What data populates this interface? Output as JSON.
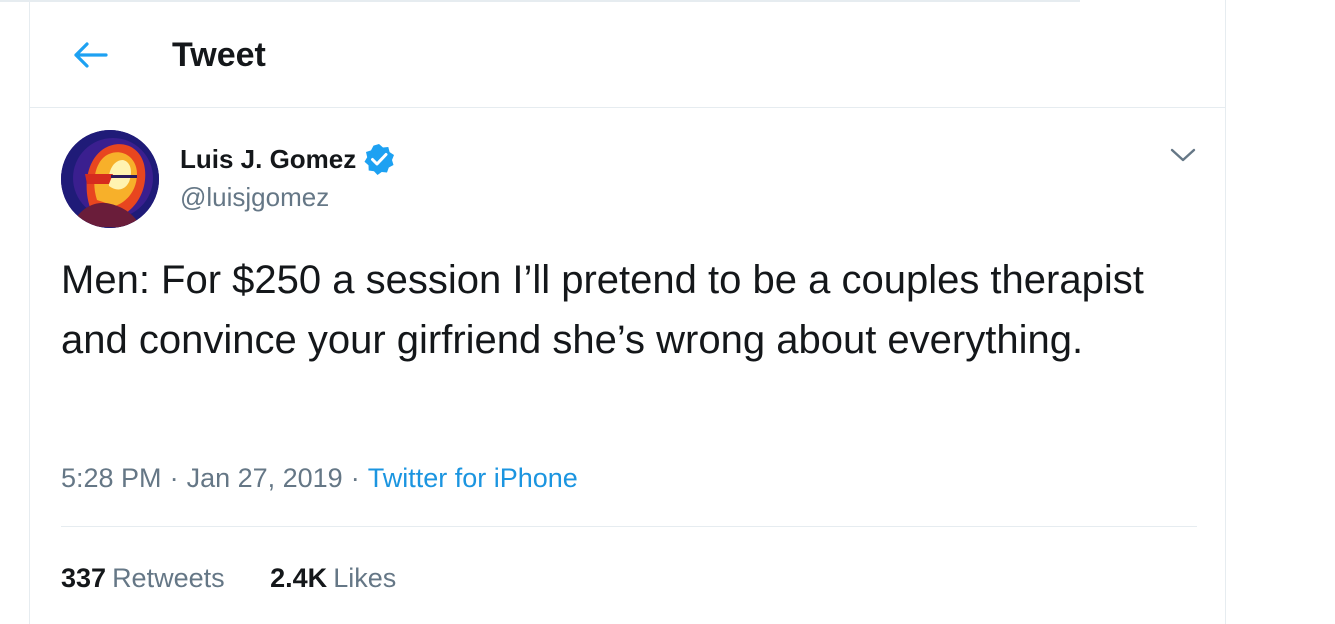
{
  "header": {
    "title": "Tweet",
    "back_icon": "arrow-left-icon"
  },
  "tweet": {
    "author": {
      "name": "Luis J. Gomez",
      "handle": "@luisjgomez",
      "verified_icon": "verified-badge-icon"
    },
    "text": "Men: For $250 a session I’ll pretend to be a couples therapist and convince your girfriend she’s wrong about everything.",
    "time": "5:28 PM",
    "date": "Jan 27, 2019",
    "separator": "·",
    "source": "Twitter for iPhone",
    "stats": {
      "retweets_count": "337",
      "retweets_label": "Retweets",
      "likes_count": "2.4K",
      "likes_label": "Likes"
    },
    "menu_icon": "chevron-down-icon"
  },
  "colors": {
    "accent": "#1b95e0",
    "text_primary": "#14171a",
    "text_secondary": "#657786",
    "border": "#e6ecf0"
  }
}
